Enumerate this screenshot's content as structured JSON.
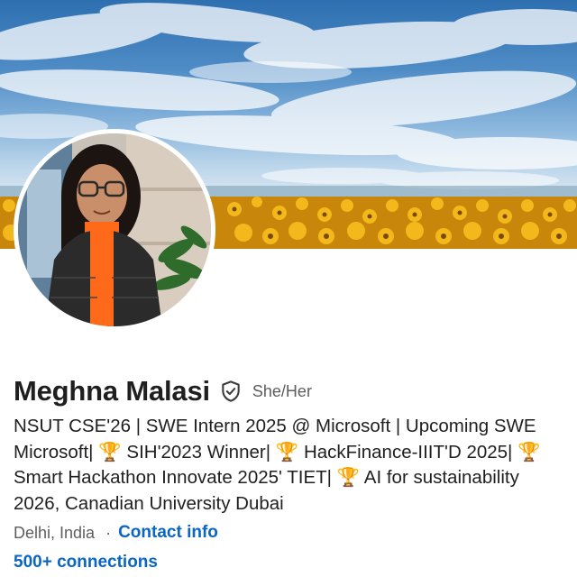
{
  "profile": {
    "name": "Meghna Malasi",
    "pronouns": "She/Her",
    "headline_lines": [
      "NSUT CSE'26 | SWE Intern 2025 @ Microsoft | Upcoming SWE",
      "Microsoft| 🏆 SIH'2023 Winner| 🏆 HackFinance-IIIT'D 2025| 🏆",
      "Smart Hackathon Innovate 2025' TIET| 🏆 AI for sustainability",
      "2026, Canadian University Dubai"
    ],
    "location": "Delhi, India",
    "separator": "·",
    "contact_info_label": "Contact info",
    "connections_label": "500+ connections"
  },
  "icons": {
    "verification": "shield-check-icon"
  },
  "colors": {
    "link": "#0a66c2",
    "text_primary": "#1f1f1f",
    "text_secondary": "#5e5e5e",
    "sky": "#4f8cc6",
    "sunflower": "#e8a512"
  }
}
